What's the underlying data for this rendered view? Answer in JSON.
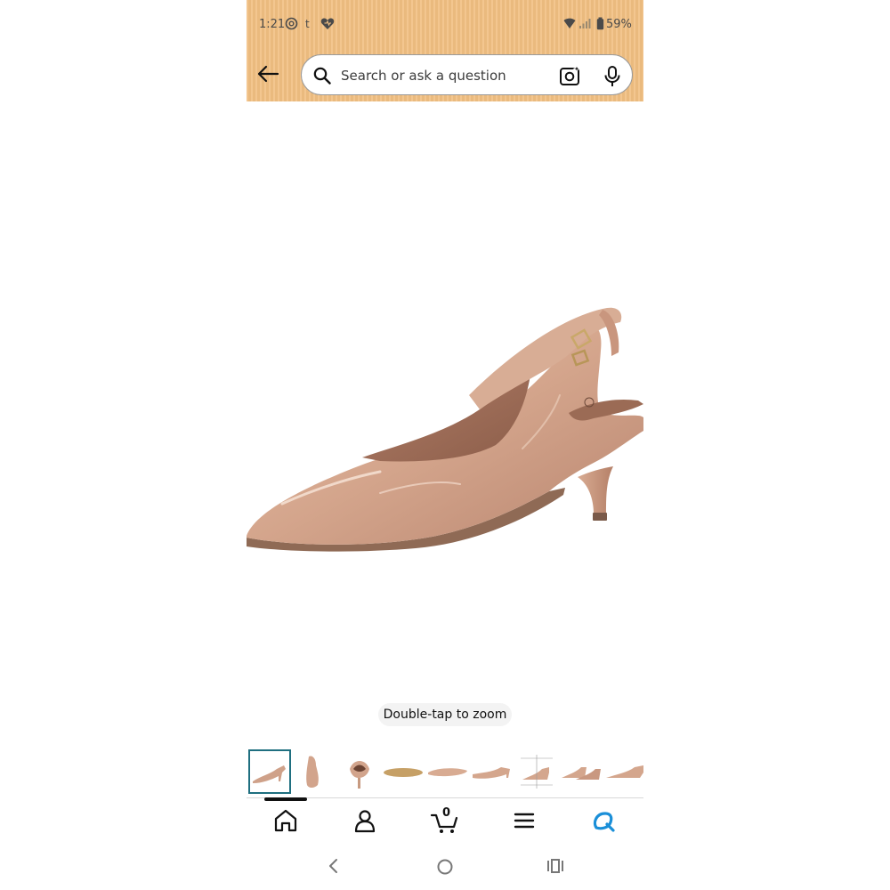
{
  "status_bar": {
    "time": "1:21",
    "battery": "59%",
    "icons": [
      "threads-icon",
      "tumblr-icon",
      "heart-icon",
      "wifi-icon",
      "signal-icon",
      "battery-icon"
    ]
  },
  "header": {
    "background_color": "#f2c082",
    "search": {
      "placeholder": "Search or ask a question",
      "value": ""
    }
  },
  "product": {
    "image_description_icon": "slingback-pump-image",
    "zoom_hint": "Double-tap to zoom"
  },
  "thumbnails": {
    "count": 9,
    "selected_index": 0,
    "accent_color": "#1f6f80"
  },
  "bottom_nav": {
    "items": [
      "home",
      "account",
      "cart",
      "menu",
      "rufus"
    ],
    "cart_count": "0",
    "rufus_color": "#1a8fd8"
  },
  "system_nav": [
    "back",
    "home",
    "recents"
  ]
}
